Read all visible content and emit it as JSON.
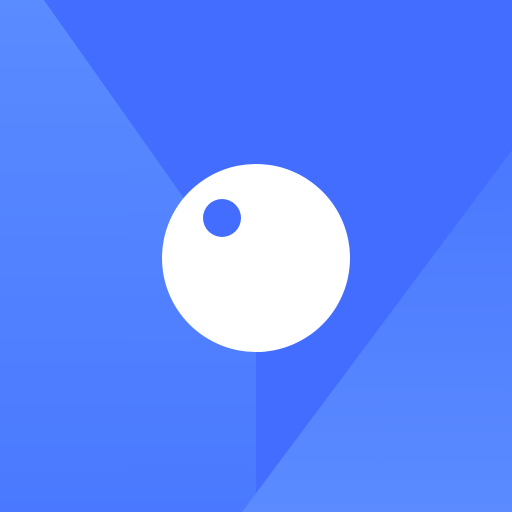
{
  "app_icon": {
    "icon": "circle-with-dot-icon",
    "colors": {
      "base_blue": "#426dff",
      "left_panel_top": "#5a8bff",
      "left_panel_bottom": "#4a79ff",
      "right_panel_top": "#4a78ff",
      "right_panel_bottom": "#5b8bff",
      "circle": "#ffffff",
      "dot": "#426dff"
    }
  }
}
